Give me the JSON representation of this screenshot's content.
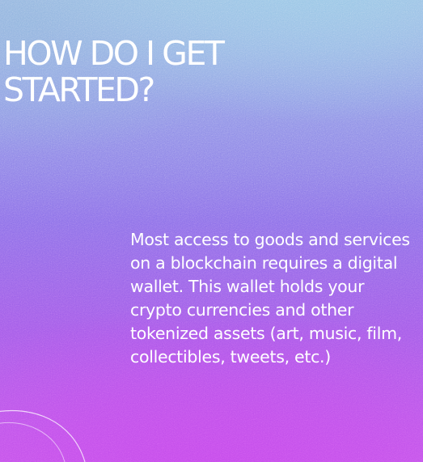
{
  "hero": {
    "heading": "HOW DO I GET\nSTARTED?",
    "body": "Most access to goods and services on a blockchain requires a digital wallet. This wallet holds your crypto currencies and other tokenized assets (art, music, film, collectibles, tweets, etc.)"
  },
  "colors": {
    "top": "#9fb8e4",
    "middle": "#8a6ee8",
    "bottom": "#c25aea",
    "text": "#ffffff"
  }
}
